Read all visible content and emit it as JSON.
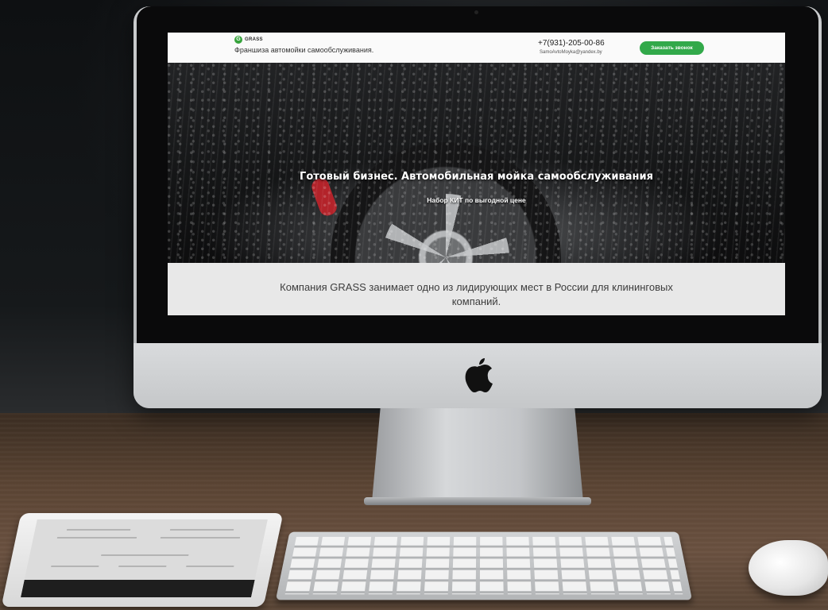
{
  "site": {
    "logo_text": "GRASS",
    "logo_mark": "G",
    "tagline": "Франшиза автомойки самообслуживания.",
    "phone": "+7(931)-205-00-86",
    "email": "SamoAvtoMoyka@yandex.by",
    "callback_button": "Заказать звонок"
  },
  "hero": {
    "title": "Готовый бизнес. Автомобильная мойка самообслуживания",
    "subtitle": "Набор КИТ по выгодной цене"
  },
  "about": {
    "text": "Компания GRASS занимает одно из лидирующих мест в России для клининговых компаний."
  },
  "colors": {
    "accent_green": "#32a94a",
    "brake_caliper": "#b3232a"
  },
  "icons": {
    "logo": "grass-logo-icon",
    "device_brand": "apple-icon"
  }
}
